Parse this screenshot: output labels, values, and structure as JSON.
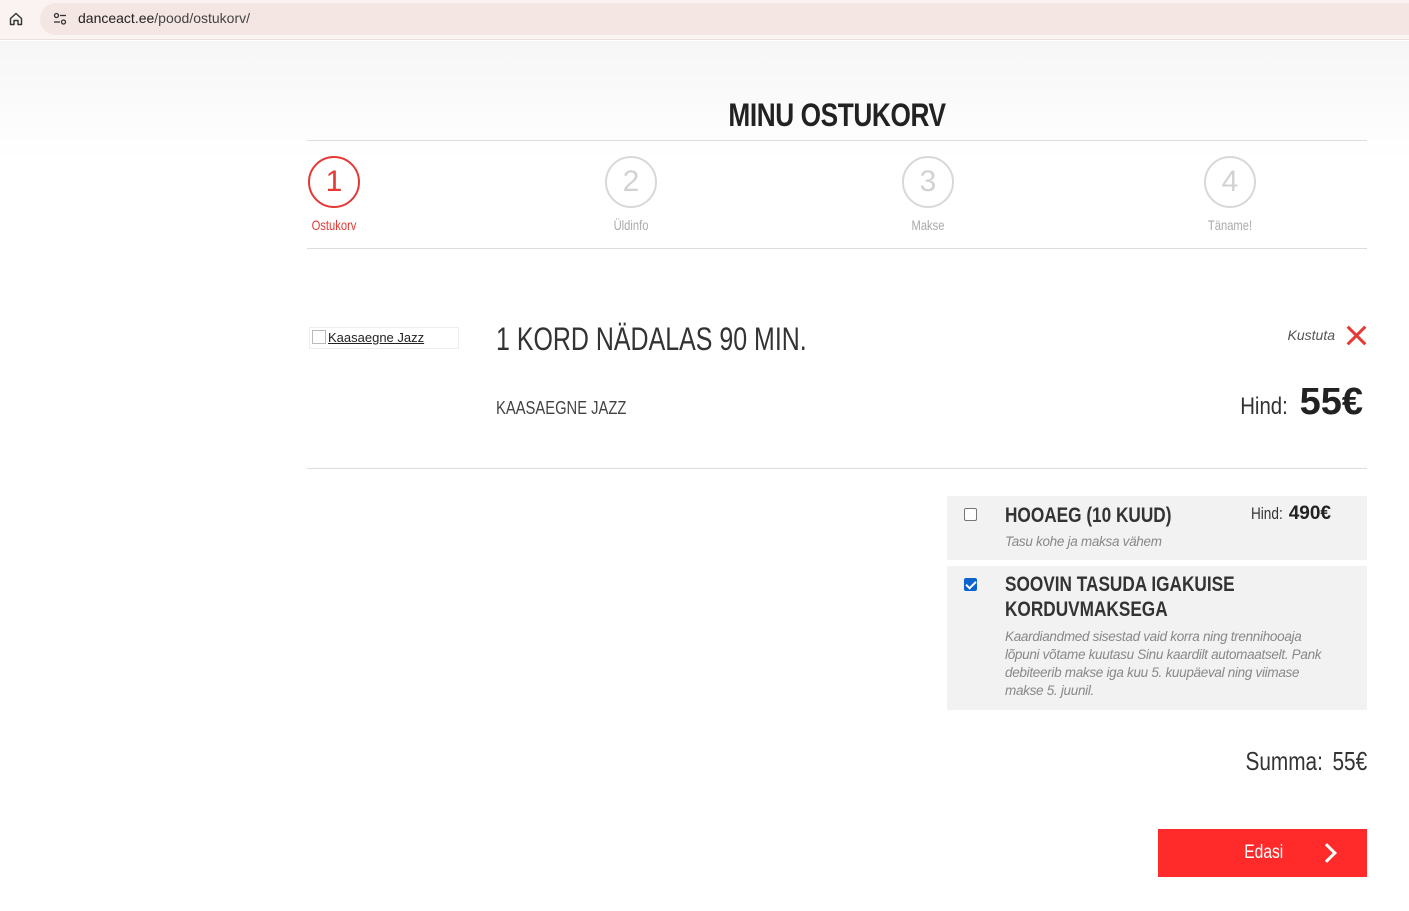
{
  "browser": {
    "url_host": "danceact.ee",
    "url_path": "/pood/ostukorv/"
  },
  "cart": {
    "title": "MINU OSTUKORV",
    "steps": [
      {
        "number": "1",
        "label": "Ostukorv",
        "active": true
      },
      {
        "number": "2",
        "label": "Üldinfo",
        "active": false
      },
      {
        "number": "3",
        "label": "Makse",
        "active": false
      },
      {
        "number": "4",
        "label": "Täname!",
        "active": false
      }
    ],
    "item": {
      "image_alt": "Kaasaegne Jazz",
      "title": "1 KORD NÄDALAS 90 MIN.",
      "category": "KAASAEGNE JAZZ",
      "delete_label": "Kustuta",
      "price_label": "Hind:",
      "price_value": "55€"
    },
    "options": [
      {
        "title": "HOOAEG (10 KUUD)",
        "description": "Tasu kohe ja maksa vähem",
        "price_label": "Hind:",
        "price_value": "490€",
        "checked": false
      },
      {
        "title": "SOOVIN TASUDA IGAKUISE KORDUVMAKSEGA",
        "description": "Kaardiandmed sisestad vaid korra ning trennihooaja lõpuni võtame kuutasu Sinu kaardilt automaatselt. Pank debiteerib makse iga kuu 5. kuupäeval ning viimase makse 5. juunil.",
        "checked": true
      }
    ],
    "total_label": "Summa:",
    "total_value": "55€",
    "next_button": "Edasi"
  },
  "colors": {
    "accent": "#e53935",
    "button": "#ff2a2a",
    "checkbox": "#0b63ce"
  }
}
